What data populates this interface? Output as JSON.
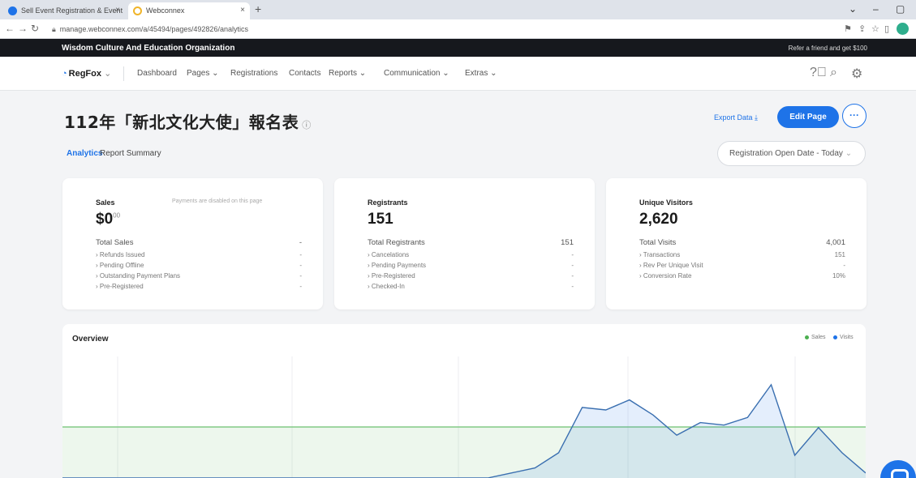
{
  "browser": {
    "tabs": [
      {
        "label": "Sell Event Registration & Event ...",
        "active": false
      },
      {
        "label": "Webconnex",
        "active": true
      }
    ],
    "new_tab": "+",
    "url": "manage.webconnex.com/a/45494/pages/492826/analytics",
    "window_controls": [
      "⌄",
      "–",
      "▢"
    ]
  },
  "org": {
    "name": "Wisdom Culture And Education Organization",
    "refer_text": "Refer a friend and get $100"
  },
  "nav": {
    "logo": "RegFox",
    "items": [
      "Dashboard",
      "Pages",
      "Registrations",
      "Contacts",
      "Reports",
      "Communication",
      "Extras"
    ],
    "dropdown_items": [
      false,
      true,
      false,
      false,
      true,
      true,
      true
    ]
  },
  "header": {
    "title": "112年「新北文化大使」報名表",
    "info_icon": "ⓘ",
    "export_label": "Export Data",
    "edit_label": "Edit Page",
    "more_label": "···"
  },
  "subtabs": {
    "analytics": "Analytics",
    "report_summary": "Report Summary"
  },
  "date_range": "Registration Open Date - Today",
  "cards": {
    "sales": {
      "title": "Sales",
      "note": "Payments are disabled on this page",
      "value": "$0",
      "value_cents": "00",
      "total_label": "Total Sales",
      "total_value": "-",
      "rows": [
        {
          "label": "Refunds Issued",
          "value": "-"
        },
        {
          "label": "Pending Offline",
          "value": "-"
        },
        {
          "label": "Outstanding Payment Plans",
          "value": "-"
        },
        {
          "label": "Pre-Registered",
          "value": "-"
        }
      ]
    },
    "registrants": {
      "title": "Registrants",
      "value": "151",
      "total_label": "Total Registrants",
      "total_value": "151",
      "rows": [
        {
          "label": "Cancelations",
          "value": "-"
        },
        {
          "label": "Pending Payments",
          "value": "-"
        },
        {
          "label": "Pre-Registered",
          "value": "-"
        },
        {
          "label": "Checked-In",
          "value": "-"
        }
      ]
    },
    "visitors": {
      "title": "Unique Visitors",
      "value": "2,620",
      "total_label": "Total Visits",
      "total_value": "4,001",
      "rows": [
        {
          "label": "Transactions",
          "value": "151"
        },
        {
          "label": "Rev Per Unique Visit",
          "value": "-"
        },
        {
          "label": "Conversion Rate",
          "value": "10%"
        }
      ]
    }
  },
  "chart": {
    "title": "Overview",
    "legend": [
      {
        "name": "Sales",
        "color": "#4caf50"
      },
      {
        "name": "Visits",
        "color": "#1e73e8"
      }
    ]
  },
  "chart_data": {
    "type": "area",
    "title": "Overview",
    "series": [
      {
        "name": "Sales",
        "values": [
          0,
          0,
          0,
          0,
          0,
          0,
          0,
          0,
          0,
          0,
          0,
          0,
          0,
          0,
          0,
          0,
          0,
          0,
          0,
          0,
          0,
          0,
          0,
          0,
          0,
          0,
          0,
          0,
          0,
          0,
          0,
          0
        ]
      },
      {
        "name": "Visits",
        "values": [
          0,
          0,
          0,
          0,
          0,
          0,
          0,
          0,
          0,
          0,
          0,
          0,
          0,
          0,
          0,
          0,
          0,
          0,
          0,
          2,
          4,
          10,
          28,
          27,
          31,
          25,
          17,
          22,
          21,
          24,
          37,
          9
        ]
      }
    ],
    "extra_visits_tail": [
      20,
      10,
      2
    ],
    "ylim": [
      0,
      45
    ],
    "grid": true
  }
}
